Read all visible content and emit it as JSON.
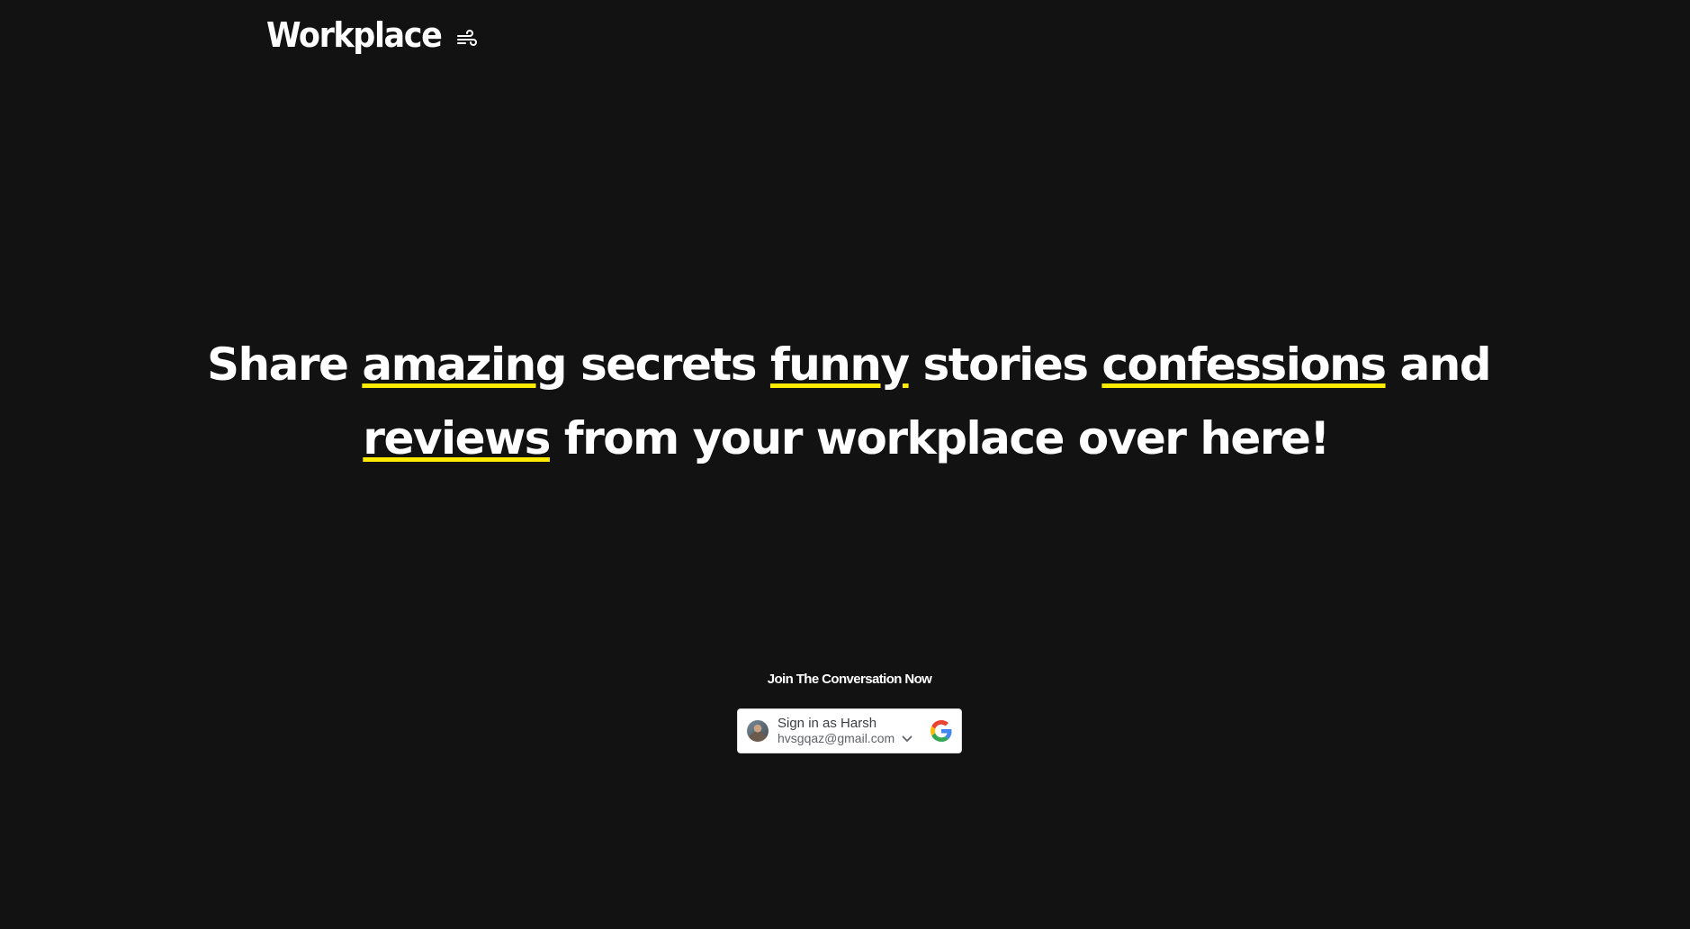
{
  "brand": {
    "name": "Workplace",
    "icon": "wind-icon"
  },
  "hero": {
    "words": [
      {
        "text": "Share",
        "highlight": false
      },
      {
        "text": "amazing",
        "highlight": true
      },
      {
        "text": "secrets",
        "highlight": false
      },
      {
        "text": "funny",
        "highlight": true
      },
      {
        "text": "stories",
        "highlight": false
      },
      {
        "text": "confessions",
        "highlight": true
      },
      {
        "text": "and",
        "highlight": false
      },
      {
        "text": "reviews",
        "highlight": true
      },
      {
        "text": "from",
        "highlight": false
      },
      {
        "text": "your",
        "highlight": false
      },
      {
        "text": "workplace",
        "highlight": false
      },
      {
        "text": "over",
        "highlight": false
      },
      {
        "text": "here!",
        "highlight": false
      }
    ],
    "highlight_color": "#ffeb00"
  },
  "cta": {
    "label": "Join The Conversation Now"
  },
  "google_signin": {
    "title": "Sign in as Harsh",
    "email": "hvsgqaz@gmail.com",
    "icons": [
      "avatar",
      "chevron-down-icon",
      "google-logo-icon"
    ]
  },
  "colors": {
    "background": "#121212",
    "text": "#ffffff",
    "accent": "#ffeb00"
  }
}
